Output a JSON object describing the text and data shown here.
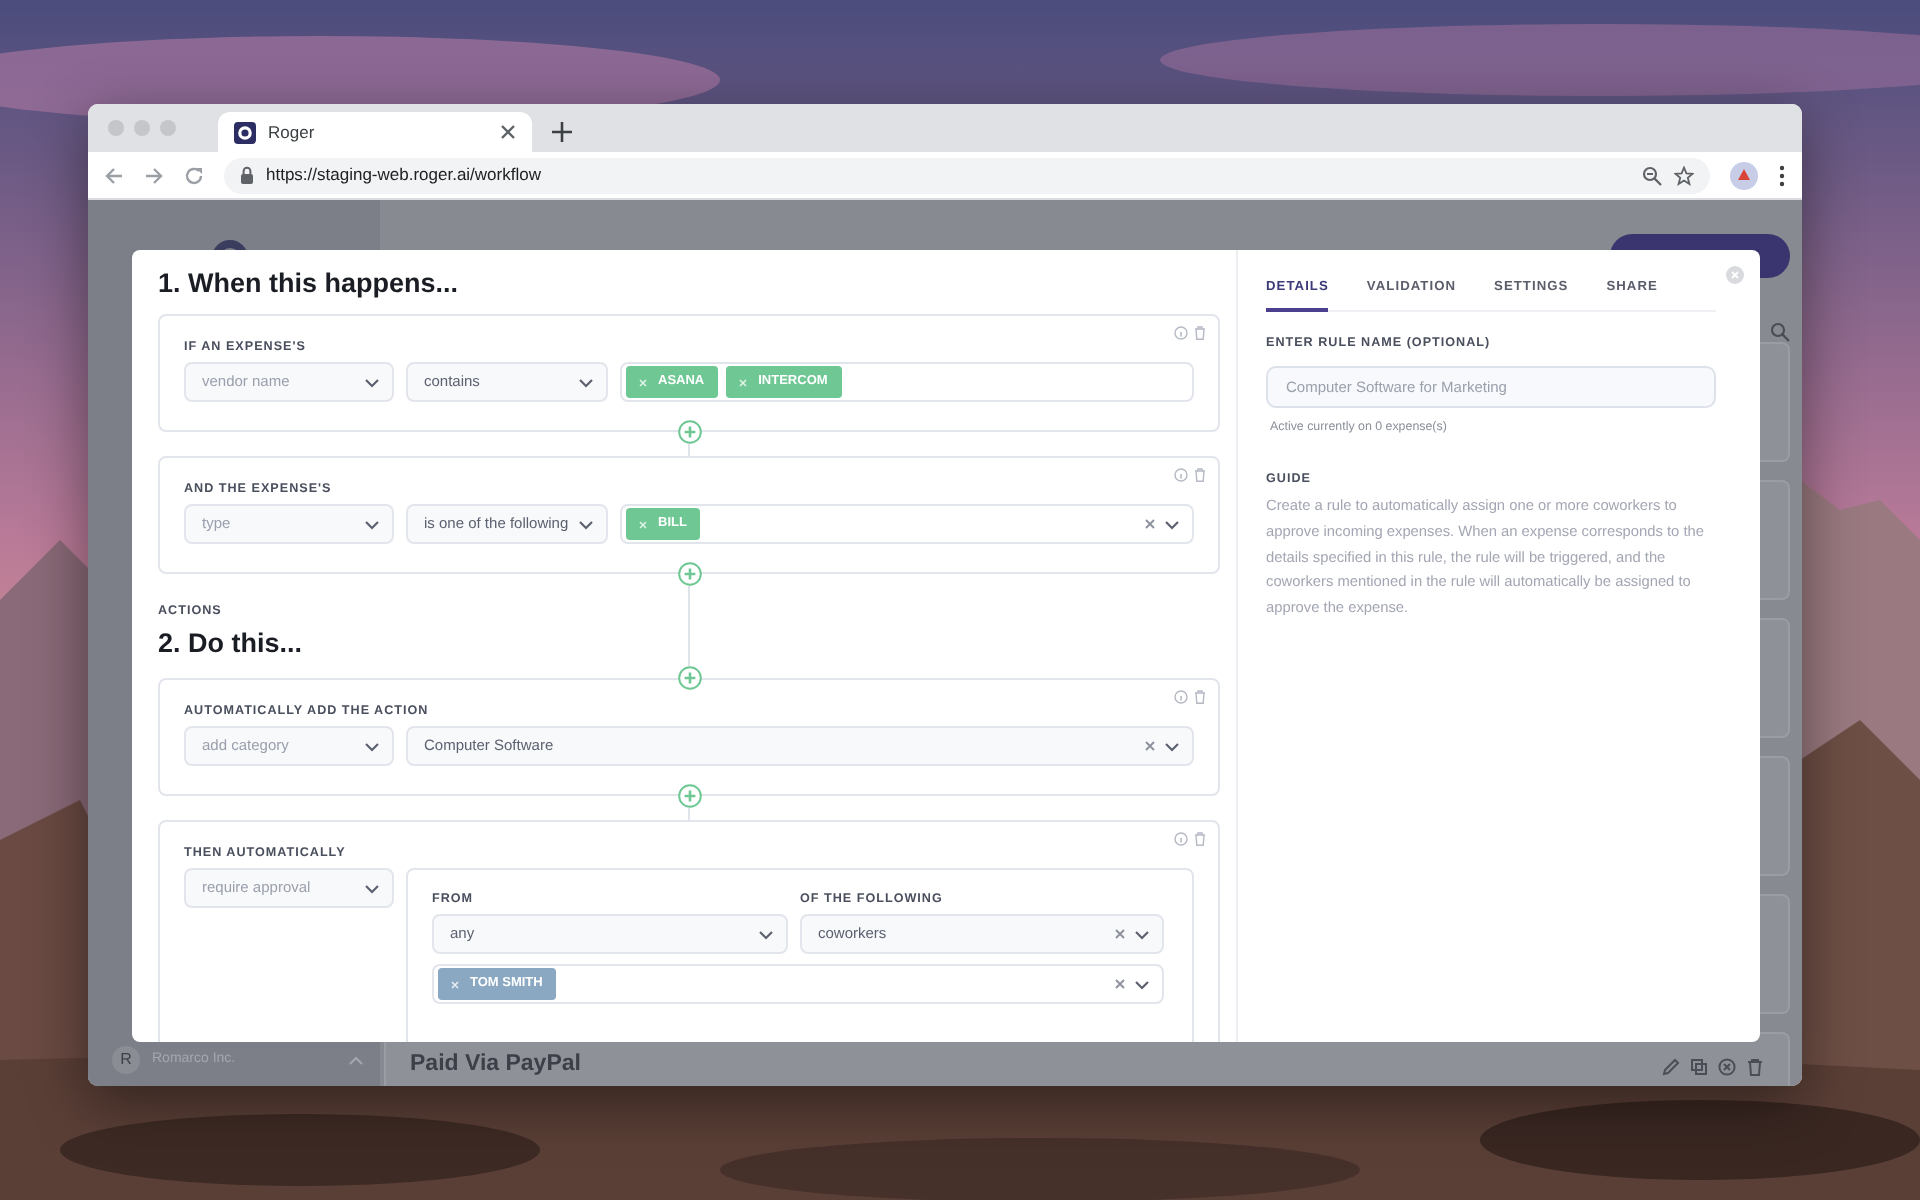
{
  "browser": {
    "tab_title": "Roger",
    "url": "https://staging-web.roger.ai/workflow"
  },
  "background_page": {
    "org_initial": "R",
    "org_name": "Romarco Inc.",
    "row_title": "Paid Via PayPal"
  },
  "trigger": {
    "heading": "1. When this happens...",
    "conditions": [
      {
        "label": "IF AN EXPENSE'S",
        "field": "vendor name",
        "operator": "contains",
        "tags": [
          "ASANA",
          "INTERCOM"
        ],
        "controls_shown": false
      },
      {
        "label": "AND THE EXPENSE'S",
        "field": "type",
        "operator": "is one of the following",
        "tags": [
          "BILL"
        ],
        "controls_shown": true
      }
    ]
  },
  "actions": {
    "caption": "ACTIONS",
    "heading": "2. Do this...",
    "steps": [
      {
        "kind": "select",
        "label": "AUTOMATICALLY ADD THE ACTION",
        "action": "add category",
        "value": "Computer Software"
      },
      {
        "kind": "approval",
        "label": "THEN AUTOMATICALLY",
        "action": "require approval",
        "from_label": "FROM",
        "from": "any",
        "of_label": "OF THE FOLLOWING",
        "of": "coworkers",
        "people": [
          "TOM SMITH"
        ]
      }
    ]
  },
  "panel": {
    "tabs": [
      {
        "label": "DETAILS",
        "selected": true
      },
      {
        "label": "VALIDATION",
        "selected": false
      },
      {
        "label": "SETTINGS",
        "selected": false
      },
      {
        "label": "SHARE",
        "selected": false
      }
    ],
    "rule_name_label": "ENTER RULE NAME (OPTIONAL)",
    "rule_name_placeholder": "Computer Software for Marketing",
    "active_note": "Active currently on 0 expense(s)",
    "guide_heading": "GUIDE",
    "guide_text": "Create a rule to automatically assign one or more coworkers to approve incoming expenses. When an expense corresponds to the details specified in this rule, the rule will be triggered, and the coworkers mentioned in the rule will automatically be assigned to approve the expense."
  }
}
